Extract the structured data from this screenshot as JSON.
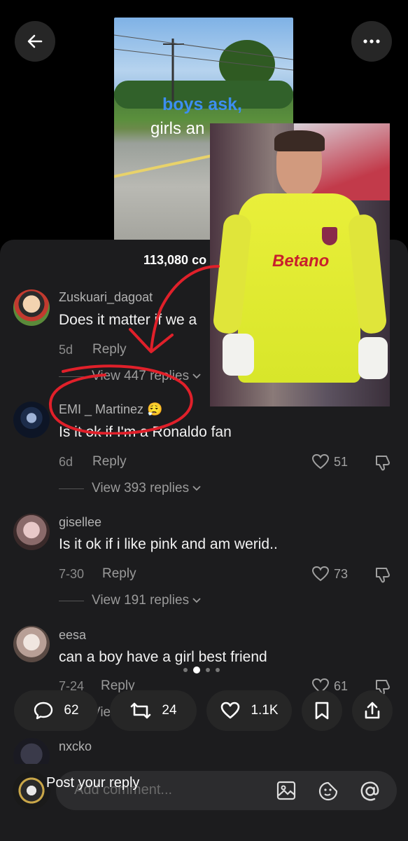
{
  "video": {
    "overlay_line1": "boys ask,",
    "overlay_line2": "girls an"
  },
  "sheet": {
    "comment_count": "113,080 co"
  },
  "comments": [
    {
      "username": "Zuskuari_dagoat",
      "text": "Does it matter if we a",
      "age": "5d",
      "reply_label": "Reply",
      "view_replies": "View 447 replies"
    },
    {
      "username": "EMI _ Martinez 😮‍💨",
      "text": "Is it ok if I'm a Ronaldo fan",
      "age": "6d",
      "reply_label": "Reply",
      "likes": "51",
      "view_replies": "View 393 replies"
    },
    {
      "username": "gisellee",
      "text": "Is it ok if i like pink and am werid..",
      "age": "7-30",
      "reply_label": "Reply",
      "likes": "73",
      "view_replies": "View 191 replies"
    },
    {
      "username": "eesa",
      "text": "can a boy have a girl best friend",
      "age": "7-24",
      "reply_label": "Reply",
      "likes": "61",
      "view_replies": "View"
    },
    {
      "username": "nxcko"
    }
  ],
  "photo": {
    "jersey_text": "Betano"
  },
  "actions": {
    "comments": "62",
    "reposts": "24",
    "likes": "1.1K"
  },
  "composer": {
    "placeholder": "Add comment...",
    "overlay_text": "Post your reply"
  },
  "icons": [
    "back-arrow-icon",
    "more-icon",
    "heart-icon",
    "dislike-icon",
    "comment-icon",
    "repost-icon",
    "bookmark-icon",
    "share-icon",
    "image-icon",
    "emoji-icon",
    "mention-icon",
    "chevron-down-icon"
  ],
  "colors": {
    "accent_red": "#e0202a",
    "sheet_bg": "#1c1c1e",
    "pill_bg": "#262626",
    "overlay_blue": "#3d8ef0"
  }
}
